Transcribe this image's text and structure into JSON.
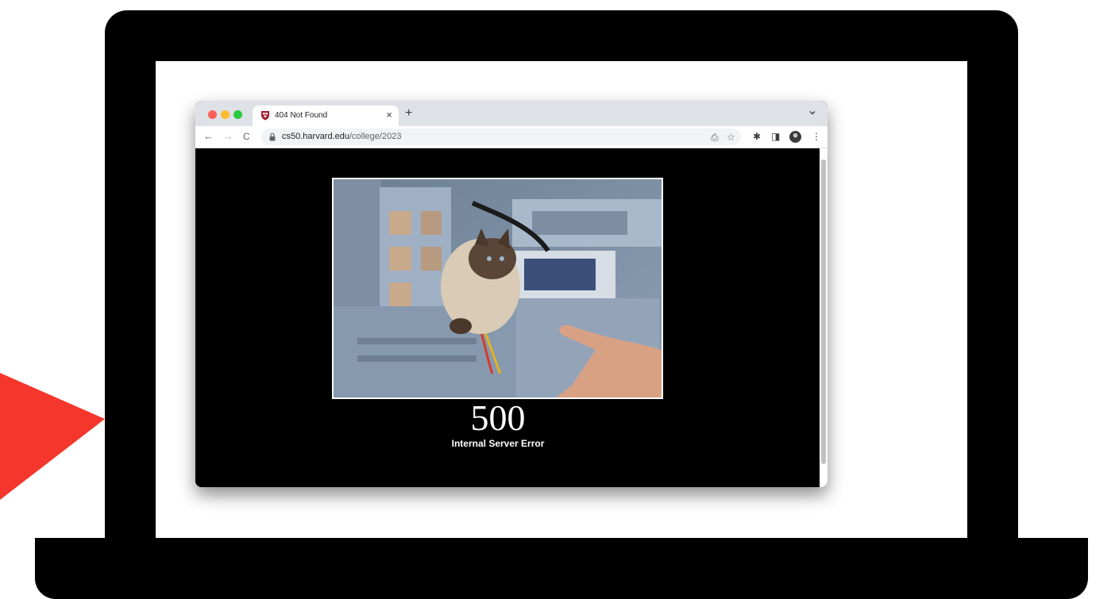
{
  "browser": {
    "tab": {
      "title": "404 Not Found",
      "close_glyph": "×"
    },
    "new_tab_glyph": "+",
    "nav": {
      "back_glyph": "←",
      "forward_glyph": "→",
      "reload_glyph": "C"
    },
    "address": {
      "host": "cs50.harvard.edu",
      "path": "/college/2023"
    },
    "toolbar_glyphs": {
      "share": "⎙",
      "star": "☆",
      "extensions": "✱",
      "side_panel": "◨",
      "menu": "⋮"
    },
    "icons": [
      "shield-icon",
      "lock-icon",
      "share-icon",
      "star-icon",
      "puzzle-icon",
      "side-panel-icon",
      "avatar",
      "kebab-menu-icon"
    ]
  },
  "page": {
    "error_code": "500",
    "error_message": "Internal Server Error"
  },
  "colors": {
    "accent_red": "#f4362c",
    "traffic_close": "#fe5f57",
    "traffic_min": "#febc2e",
    "traffic_max": "#28c840"
  }
}
